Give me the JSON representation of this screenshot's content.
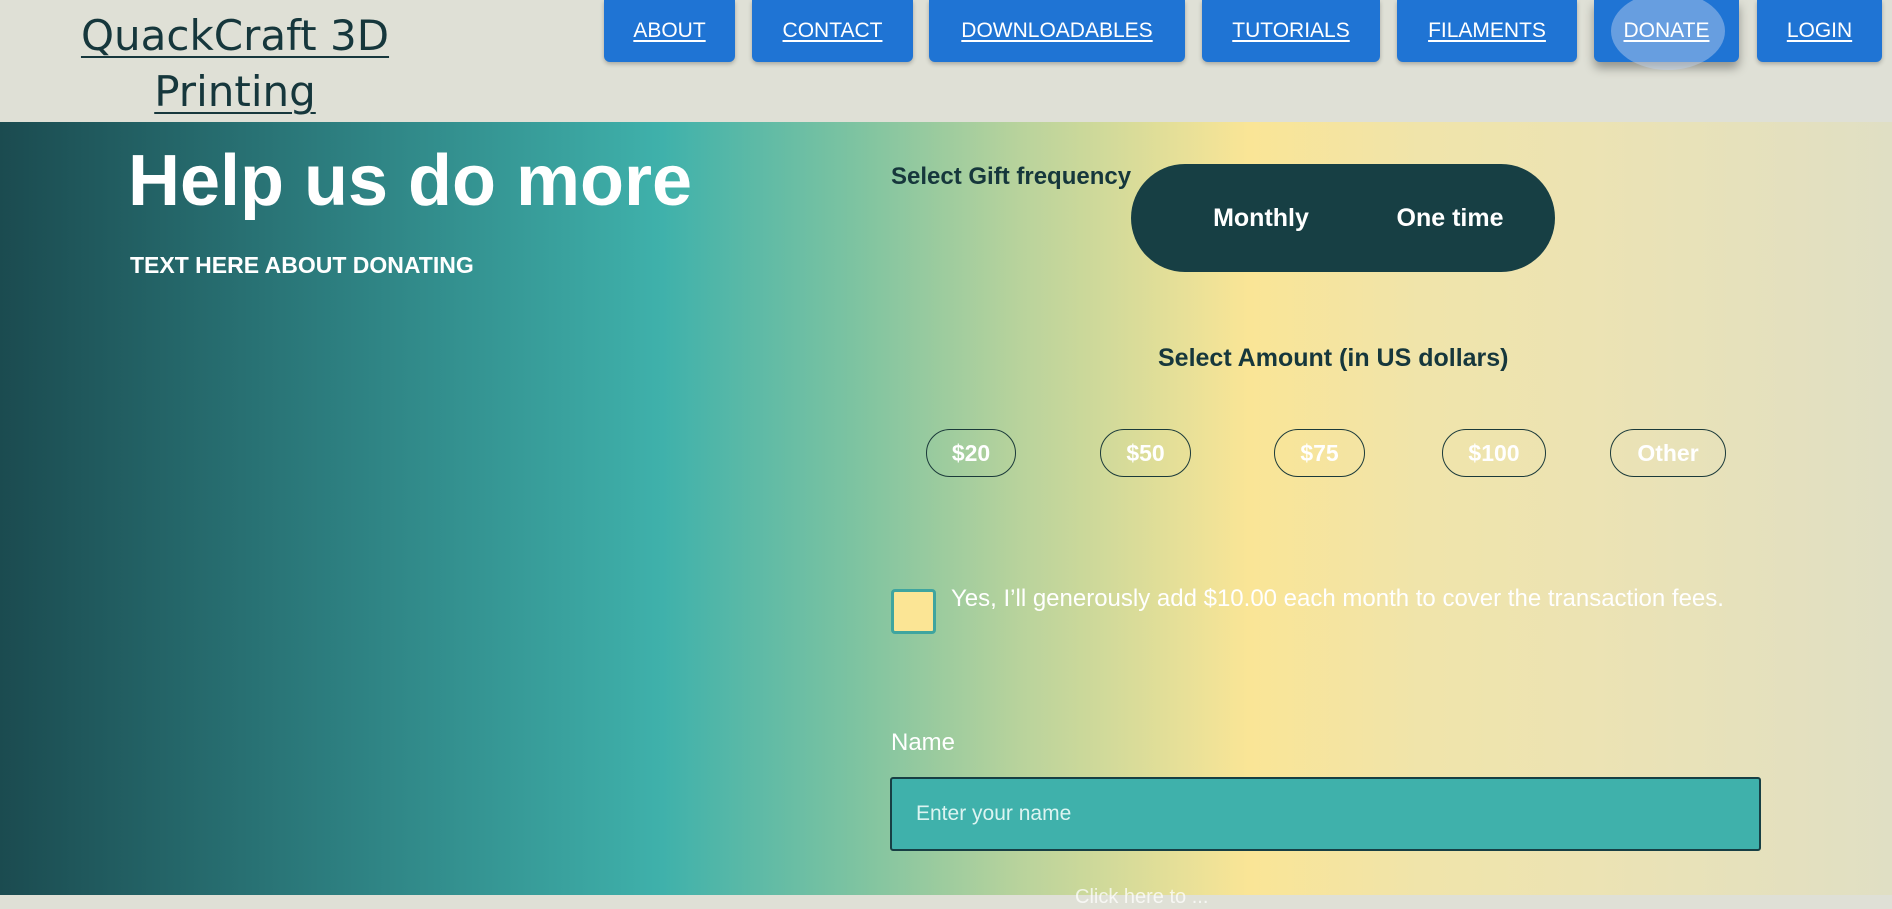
{
  "header": {
    "logo_line1": "QuackCraft 3D",
    "logo_line2": "Printing",
    "nav": [
      {
        "label": "ABOUT"
      },
      {
        "label": "CONTACT"
      },
      {
        "label": "DOWNLOADABLES"
      },
      {
        "label": "TUTORIALS"
      },
      {
        "label": "FILAMENTS"
      },
      {
        "label": "DONATE",
        "active": true
      },
      {
        "label": "LOGIN"
      }
    ]
  },
  "hero": {
    "title": "Help us do more",
    "subtitle": "TEXT HERE ABOUT DONATING"
  },
  "form": {
    "frequency_label": "Select Gift frequency",
    "frequency_options": [
      "Monthly",
      "One time"
    ],
    "amount_label": "Select Amount (in US dollars)",
    "amounts": [
      "$20",
      "$50",
      "$75",
      "$100",
      "Other"
    ],
    "fee_checkbox_label": "Yes, I’ll generously add $10.00 each month to cover the transaction fees.",
    "name_label": "Name",
    "name_placeholder": "Enter your name",
    "name_value": "",
    "bottom_text_partial": "Click here to ..."
  },
  "colors": {
    "nav_blue": "#1f74d4",
    "dark_teal": "#173f44",
    "teal": "#3fb1ab",
    "yellow": "#fae596",
    "header_bg": "#dfe0d6"
  }
}
